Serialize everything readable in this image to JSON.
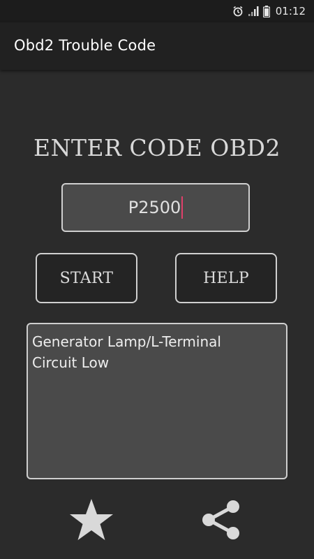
{
  "status_bar": {
    "time": "01:12",
    "icons": [
      "alarm-icon",
      "signal-icon",
      "battery-icon"
    ]
  },
  "app_bar": {
    "title": "Obd2 Trouble Code"
  },
  "main": {
    "heading": "ENTER CODE OBD2",
    "code_input": {
      "value": "P2500"
    },
    "start_label": "START",
    "help_label": "HELP",
    "result_line1": "Generator Lamp/L-Terminal",
    "result_line2": "Circuit Low"
  },
  "bottom": {
    "icons": [
      "star-icon",
      "share-icon"
    ]
  },
  "colors": {
    "background": "#2b2b2b",
    "app_bar": "#212121",
    "input_fill": "#4a4a4a",
    "border": "#cfcfcf",
    "caret": "#e0406a",
    "icon": "#d9d9d9"
  }
}
